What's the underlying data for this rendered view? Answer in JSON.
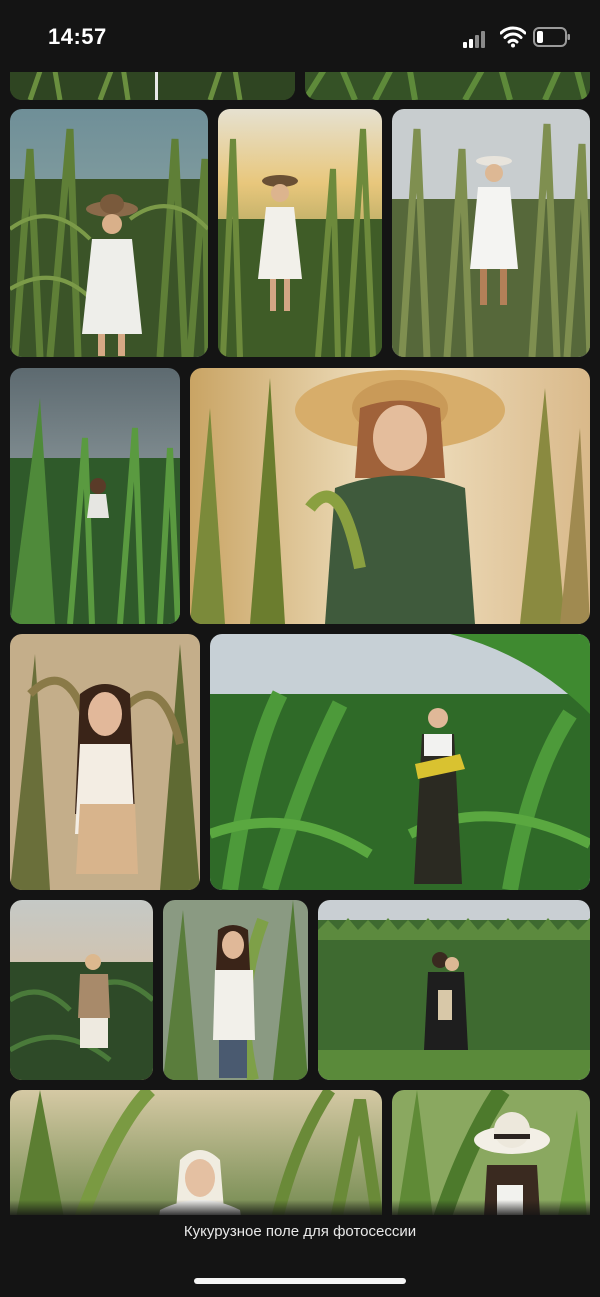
{
  "status_bar": {
    "time": "14:57",
    "icons": [
      "cellular-signal-icon",
      "wifi-icon",
      "battery-icon"
    ]
  },
  "gallery": {
    "caption": "Кукурузное поле для фотосессии",
    "photos": [
      "corn-field-photo",
      "corn-field-photo",
      "woman-straw-hat-white-dress-corn-field",
      "woman-hat-white-dress-sunset-corn",
      "woman-white-shirt-hat-corn-field",
      "woman-white-dress-tall-corn-field",
      "woman-straw-hat-polka-dot-dress-corn",
      "woman-long-hair-corn-field",
      "woman-holding-corn-cobs-green-field",
      "woman-white-shorts-corn-field-sunset",
      "woman-white-shirt-between-corn-leaves",
      "couple-in-corn-field",
      "blonde-woman-corn-field",
      "woman-white-hat-corn-leaves"
    ]
  },
  "colors": {
    "background": "#141414",
    "caption_text": "#e9e9e9",
    "leaf_green": "#4f7a33"
  }
}
